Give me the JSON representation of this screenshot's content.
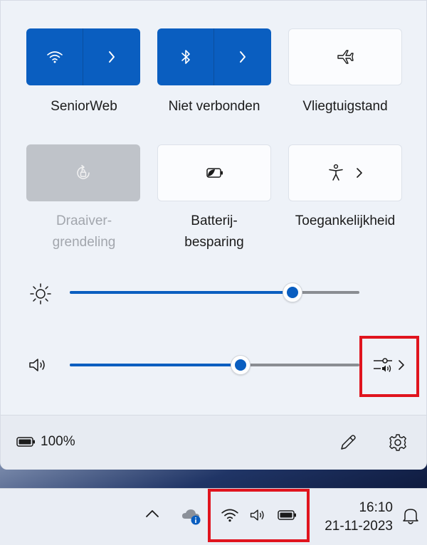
{
  "quick_settings": {
    "tiles": [
      {
        "label": "SeniorWeb",
        "icon": "wifi-icon",
        "state": "on",
        "has_expand": true
      },
      {
        "label": "Niet verbonden",
        "icon": "bluetooth-icon",
        "state": "on",
        "has_expand": true
      },
      {
        "label": "Vliegtuigstand",
        "icon": "airplane-icon",
        "state": "off",
        "has_expand": false
      },
      {
        "label": "Draaiver-\ngrendeling",
        "icon": "rotation-lock-icon",
        "state": "disabled",
        "has_expand": false
      },
      {
        "label": "Batterij-\nbesparing",
        "icon": "battery-saver-icon",
        "state": "off",
        "has_expand": false
      },
      {
        "label": "Toegankelijkheid",
        "icon": "accessibility-icon",
        "state": "off",
        "has_expand": true
      }
    ],
    "brightness": {
      "icon": "brightness-icon",
      "value_percent": 77
    },
    "volume": {
      "icon": "speaker-icon",
      "value_percent": 59,
      "mixer_icon": "sound-mixer-icon"
    },
    "battery": {
      "icon": "battery-icon",
      "text": "100%"
    },
    "edit_icon": "pencil-icon",
    "settings_icon": "gear-icon"
  },
  "taskbar": {
    "overflow_icon": "chevron-up-icon",
    "onedrive_icon": "onedrive-icon",
    "tray_icons": [
      "wifi-icon",
      "speaker-icon",
      "battery-icon"
    ],
    "time": "16:10",
    "date": "21-11-2023",
    "notification_icon": "bell-icon"
  },
  "colors": {
    "accent": "#0a5ec0",
    "highlight": "#e0141e"
  }
}
